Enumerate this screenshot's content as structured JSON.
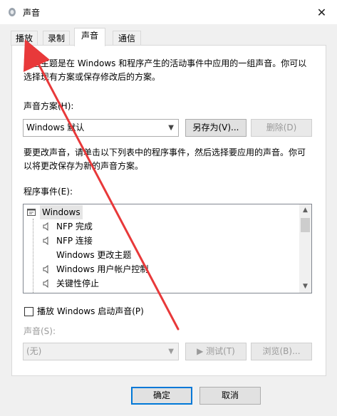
{
  "window": {
    "title": "声音",
    "close_label": "✕"
  },
  "tabs": [
    {
      "label": "播放",
      "active": false
    },
    {
      "label": "录制",
      "active": false
    },
    {
      "label": "声音",
      "active": true
    },
    {
      "label": "通信",
      "active": false
    }
  ],
  "sounds_tab": {
    "description": "声音主题是在 Windows 和程序产生的活动事件中应用的一组声音。你可以选择现有方案或保存修改后的方案。",
    "description_line1": "声音主题是在 Windows 和程序产生的活动事件中应用的一组声音。你可以",
    "description_line2": "选择现有方案或保存修改后的方案。",
    "scheme_label": "声音方案(H):",
    "scheme_value": "Windows 默认",
    "save_as_label": "另存为(V)...",
    "delete_label": "删除(D)",
    "instructions_line1": "要更改声音，请单击以下列表中的程序事件，然后选择要应用的声音。你可",
    "instructions_line2": "以将更改保存为新的声音方案。",
    "events_label": "程序事件(E):",
    "events": [
      {
        "label": "Windows",
        "indent": 0,
        "icon": "windows-group-icon",
        "selected": true
      },
      {
        "label": "NFP 完成",
        "indent": 1,
        "icon": "speaker-icon"
      },
      {
        "label": "NFP 连接",
        "indent": 1,
        "icon": "speaker-icon"
      },
      {
        "label": "Windows 更改主题",
        "indent": 1,
        "icon": ""
      },
      {
        "label": "Windows 用户帐户控制",
        "indent": 1,
        "icon": "speaker-icon"
      },
      {
        "label": "关键性停止",
        "indent": 1,
        "icon": "speaker-icon"
      }
    ],
    "startup_checkbox_label": "播放 Windows 启动声音(P)",
    "startup_checked": false,
    "sound_label": "声音(S):",
    "sound_value": "(无)",
    "test_label": "▶ 测试(T)",
    "browse_label": "浏览(B)..."
  },
  "footer": {
    "ok_label": "确定",
    "cancel_label": "取消"
  },
  "colors": {
    "accent": "#0078d7",
    "annotation": "#e8393a"
  }
}
